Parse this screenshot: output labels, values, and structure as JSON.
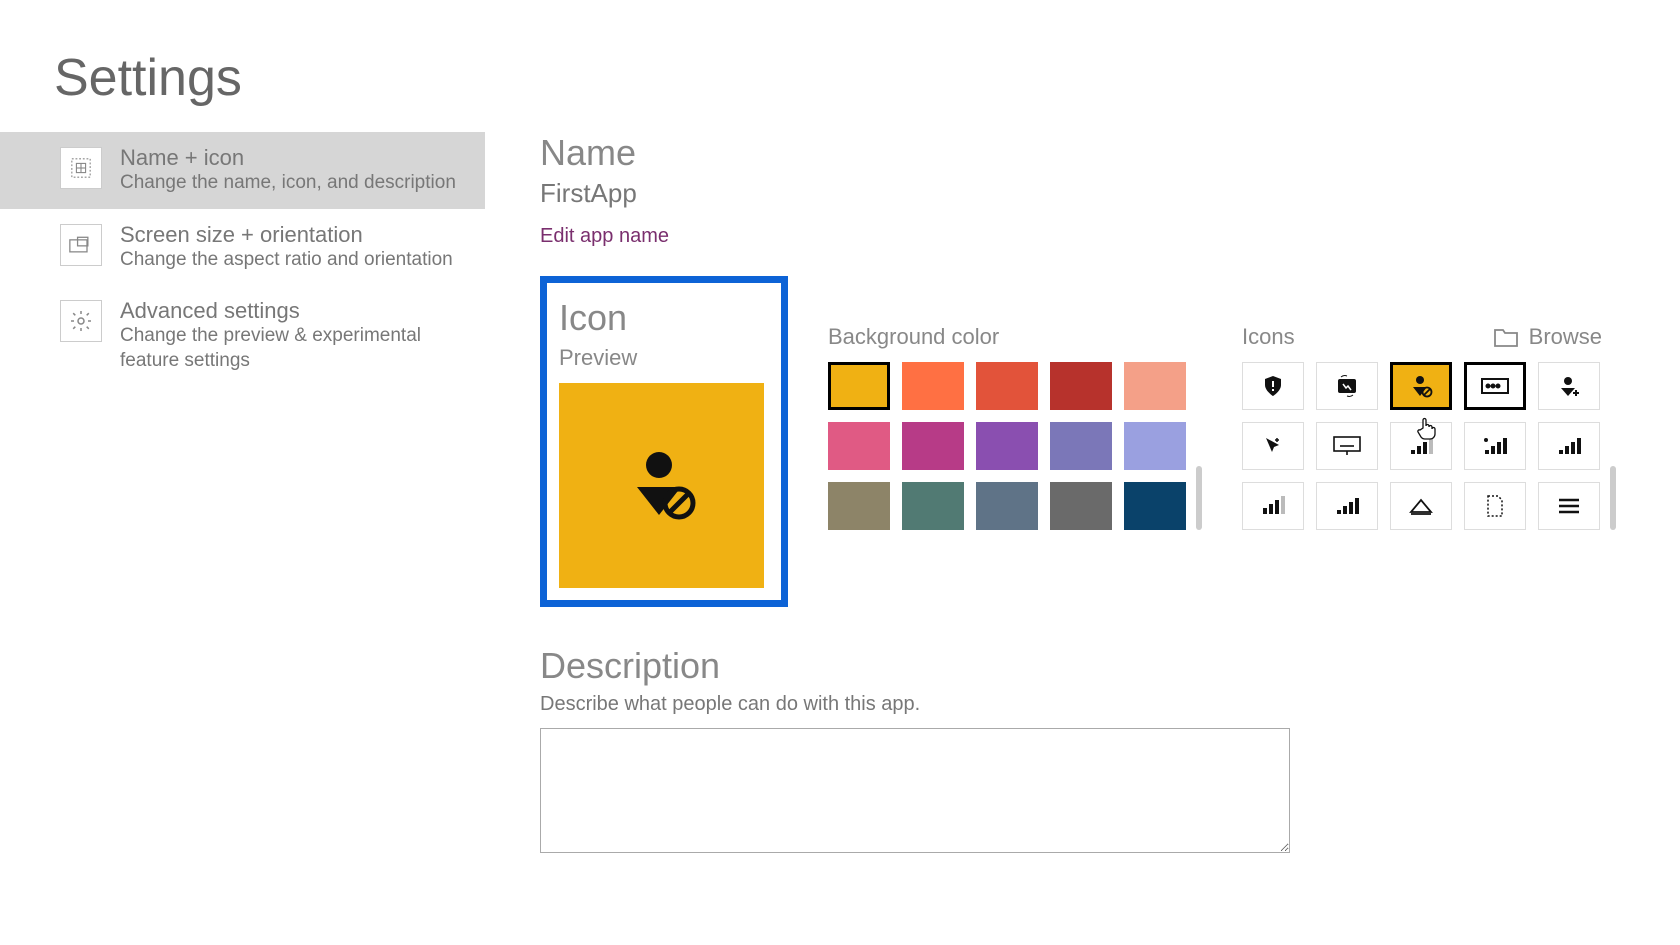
{
  "page_title": "Settings",
  "sidebar": {
    "items": [
      {
        "title": "Name + icon",
        "subtitle": "Change the name, icon, and description",
        "icon": "grid-icon",
        "active": true
      },
      {
        "title": "Screen size + orientation",
        "subtitle": "Change the aspect ratio and orientation",
        "icon": "screen-icon",
        "active": false
      },
      {
        "title": "Advanced settings",
        "subtitle": "Change the preview & experimental feature settings",
        "icon": "gear-icon",
        "active": false
      }
    ]
  },
  "name_section": {
    "heading": "Name",
    "value": "FirstApp",
    "edit_link": "Edit app name"
  },
  "icon_section": {
    "heading": "Icon",
    "preview_label": "Preview",
    "bg_label": "Background color",
    "icons_label": "Icons",
    "browse_label": "Browse",
    "selected_color": "#f0b113",
    "colors_row1": [
      "#f0b113",
      "#ff7043",
      "#e2533a",
      "#b7322c",
      "#f4a088"
    ],
    "colors_row2": [
      "#e05a84",
      "#b73b87",
      "#8a4fb0",
      "#7b77b8",
      "#9aa0e0"
    ],
    "colors_row3": [
      "#8d8468",
      "#517a73",
      "#5f7387",
      "#6a6a6a",
      "#0a426a"
    ],
    "icon_names_row1": [
      "shield-alert-icon",
      "swap-photo-icon",
      "user-block-icon",
      "input-slot-icon",
      "user-add-icon"
    ],
    "icon_names_row2": [
      "pointer-plus-icon",
      "keyboard-icon",
      "bars-signal-1-icon",
      "bars-dot-icon",
      "bars-signal-2-icon"
    ],
    "icon_names_row3": [
      "bars-up-icon",
      "bars-signal-3-icon",
      "send-plane-icon",
      "dashed-doc-icon",
      "menu-lines-icon"
    ],
    "selected_icon_index": 2
  },
  "description_section": {
    "heading": "Description",
    "subtitle": "Describe what people can do with this app.",
    "value": ""
  }
}
